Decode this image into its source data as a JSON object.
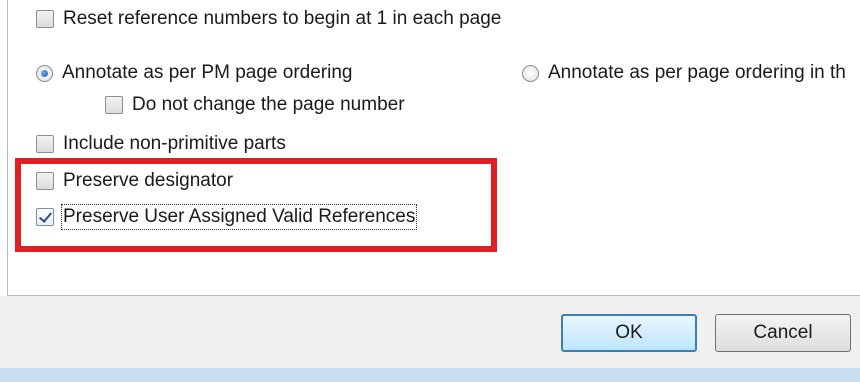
{
  "options": {
    "reset_reference": {
      "label": "Reset reference numbers to begin at 1 in each page",
      "checked": false
    },
    "annotate_pm": {
      "label": "Annotate as per PM page ordering",
      "selected": true
    },
    "do_not_change_page": {
      "label": "Do not change the page number",
      "checked": false
    },
    "annotate_other": {
      "label": "Annotate as per page ordering in th",
      "selected": false
    },
    "include_non_primitive": {
      "label": "Include non-primitive parts",
      "checked": false
    },
    "preserve_designator": {
      "label": "Preserve designator",
      "checked": false
    },
    "preserve_user_refs": {
      "label": "Preserve User Assigned Valid References",
      "checked": true
    }
  },
  "buttons": {
    "ok_label": "OK",
    "cancel_label": "Cancel"
  },
  "colors": {
    "highlight": "#e01e24",
    "footer": "#f0f0f0",
    "ok_border": "#3c7fb1"
  }
}
